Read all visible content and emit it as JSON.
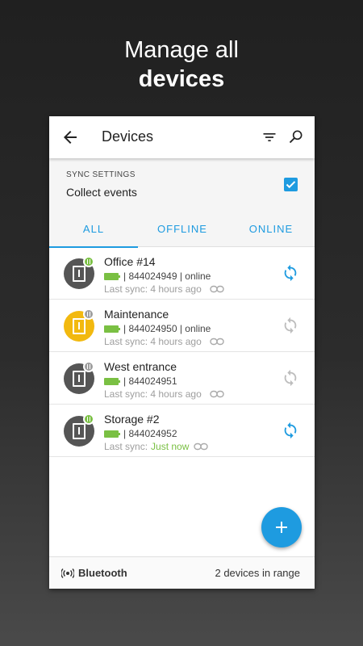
{
  "headline": {
    "line1": "Manage all",
    "line2": "devices"
  },
  "appbar": {
    "title": "Devices"
  },
  "sync": {
    "caption": "SYNC SETTINGS",
    "value": "Collect events",
    "checked": true
  },
  "tabs": [
    {
      "label": "ALL",
      "active": true
    },
    {
      "label": "OFFLINE",
      "active": false
    },
    {
      "label": "ONLINE",
      "active": false
    }
  ],
  "devices": [
    {
      "name": "Office #14",
      "meta": "| 844024949 | online",
      "last_prefix": "Last sync: 4 hours ago",
      "last_highlight": "",
      "avatar": "gray",
      "badge": "green",
      "sync_active": true
    },
    {
      "name": "Maintenance",
      "meta": "| 844024950 | online",
      "last_prefix": "Last sync: 4 hours ago",
      "last_highlight": "",
      "avatar": "yellow",
      "badge": "gray",
      "sync_active": false
    },
    {
      "name": "West entrance",
      "meta": "| 844024951",
      "last_prefix": "Last sync: 4 hours ago",
      "last_highlight": "",
      "avatar": "gray",
      "badge": "gray",
      "sync_active": false
    },
    {
      "name": "Storage #2",
      "meta": "| 844024952",
      "last_prefix": "Last sync:",
      "last_highlight": "Just now",
      "avatar": "gray",
      "badge": "green",
      "sync_active": true
    }
  ],
  "bottombar": {
    "label": "Bluetooth",
    "range": "2 devices in range"
  },
  "colors": {
    "accent": "#1e9be0",
    "green": "#7ac043",
    "yellow": "#f2b90f",
    "inactive": "#bdbdbd"
  }
}
